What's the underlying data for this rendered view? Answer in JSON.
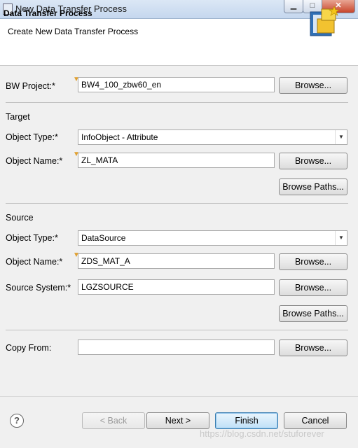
{
  "window": {
    "title": "New Data Transfer Process",
    "minimize": "▁",
    "maximize": "□",
    "close": "✕"
  },
  "header": {
    "title": "Data Transfer Process",
    "subtitle": "Create New Data Transfer Process"
  },
  "project": {
    "label": "BW Project:*",
    "value": "BW4_100_zbw60_en",
    "browse": "Browse..."
  },
  "target": {
    "section": "Target",
    "type_label": "Object Type:*",
    "type_value": "InfoObject - Attribute",
    "name_label": "Object Name:*",
    "name_value": "ZL_MATA",
    "browse": "Browse...",
    "browse_paths": "Browse Paths..."
  },
  "source": {
    "section": "Source",
    "type_label": "Object Type:*",
    "type_value": "DataSource",
    "name_label": "Object Name:*",
    "name_value": "ZDS_MAT_A",
    "system_label": "Source System:*",
    "system_value": "LGZSOURCE",
    "browse_name": "Browse...",
    "browse_system": "Browse...",
    "browse_paths": "Browse Paths..."
  },
  "copy": {
    "label": "Copy From:",
    "value": "",
    "browse": "Browse..."
  },
  "footer": {
    "help": "?",
    "back": "< Back",
    "next": "Next >",
    "finish": "Finish",
    "cancel": "Cancel"
  },
  "watermark": "https://blog.csdn.net/stuforever",
  "icons": {
    "required_marker": "required-marker-icon",
    "wizard": "wizard-banner-icon",
    "help": "help-icon"
  }
}
